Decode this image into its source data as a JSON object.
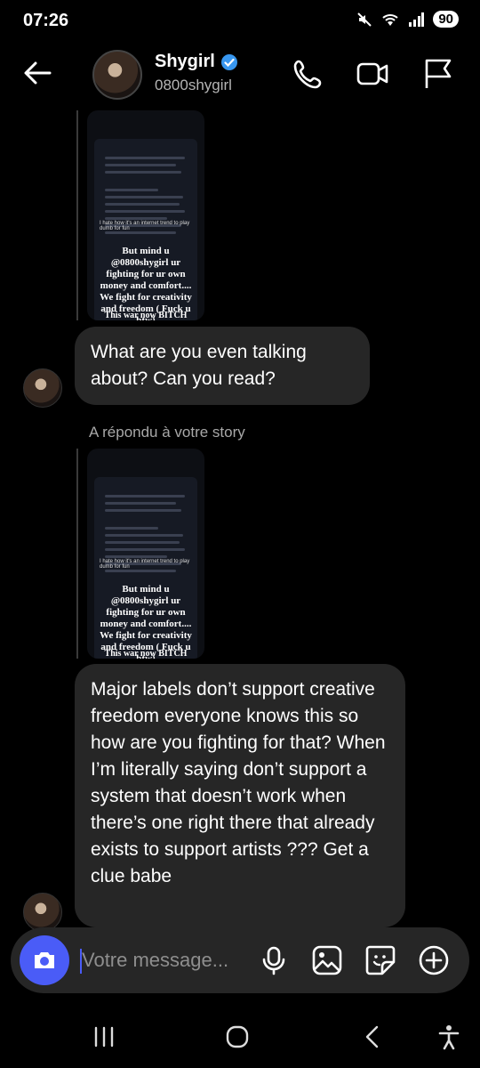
{
  "status": {
    "time": "07:26",
    "battery": "90"
  },
  "header": {
    "name": "Shygirl",
    "handle": "0800shygirl",
    "verified": true
  },
  "story_preview": {
    "caption_small": "I hate how it's an internet trend to play dumb for fun",
    "caption_main": "But mind u @0800shygirl ur fighting for ur own money and comfort.... We fight for creativity and freedom ( Fuck u btw)",
    "caption_footer": "This war now BITCH"
  },
  "messages": [
    {
      "text": "What are you even talking about? Can you read?"
    },
    {
      "replied_label": "A répondu à votre story"
    },
    {
      "text": "Major labels don’t support creative freedom everyone knows this so how are you fighting for that? When I’m literally saying don’t support a system that doesn’t work when there’s one right there that already exists to support artists ??? Get a clue babe"
    }
  ],
  "composer": {
    "placeholder": "Votre message..."
  },
  "colors": {
    "accent": "#4a5cf7",
    "bubble": "#262626",
    "verified": "#3897f0"
  }
}
